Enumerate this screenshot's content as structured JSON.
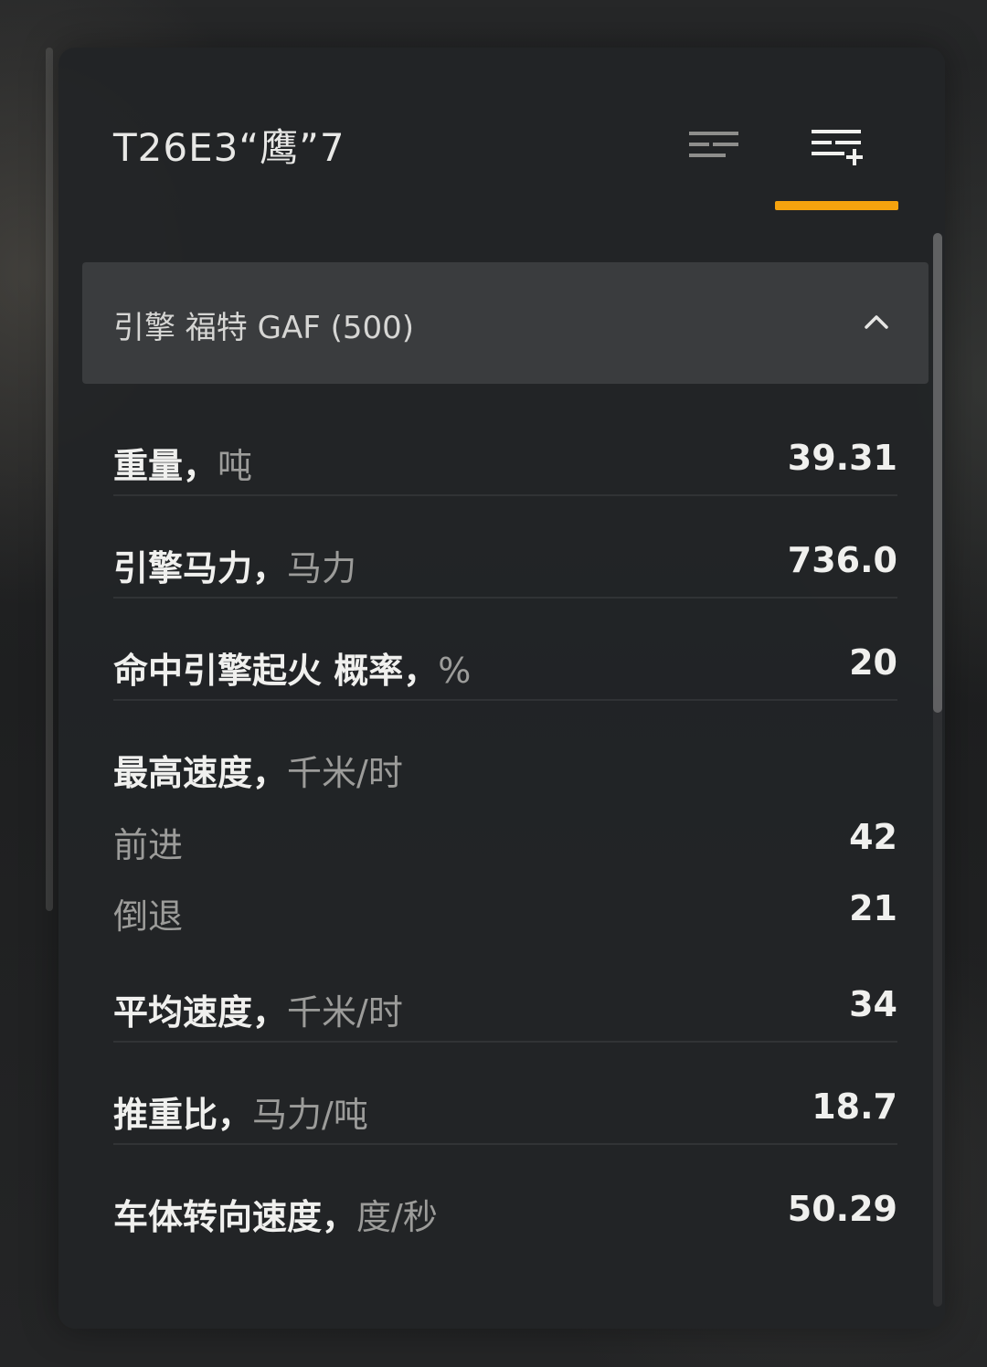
{
  "vehicle": {
    "name": "T26E3“鹰”7"
  },
  "tabs": {
    "basic_icon": "list-icon",
    "advanced_icon": "list-add-icon",
    "active": "advanced",
    "accent_color": "#f5a30e"
  },
  "section": {
    "title": "引擎 福特 GAF (500)",
    "state": "expanded",
    "icon": "chevron-up-icon"
  },
  "stats": {
    "weight": {
      "label": "重量，",
      "unit": "吨",
      "value": "39.31"
    },
    "horsepower": {
      "label": "引擎马力，",
      "unit": "马力",
      "value": "736.0"
    },
    "fire_chance": {
      "label": "命中引擎起火 概率，",
      "unit": "%",
      "value": "20"
    },
    "top_speed": {
      "label": "最高速度，",
      "unit": "千米/时",
      "forward_label": "前进",
      "forward_value": "42",
      "reverse_label": "倒退",
      "reverse_value": "21"
    },
    "avg_speed": {
      "label": "平均速度，",
      "unit": "千米/时",
      "value": "34"
    },
    "power_ratio": {
      "label": "推重比，",
      "unit": "马力/吨",
      "value": "18.7"
    },
    "traverse": {
      "label": "车体转向速度，",
      "unit": "度/秒",
      "value": "50.29"
    }
  }
}
